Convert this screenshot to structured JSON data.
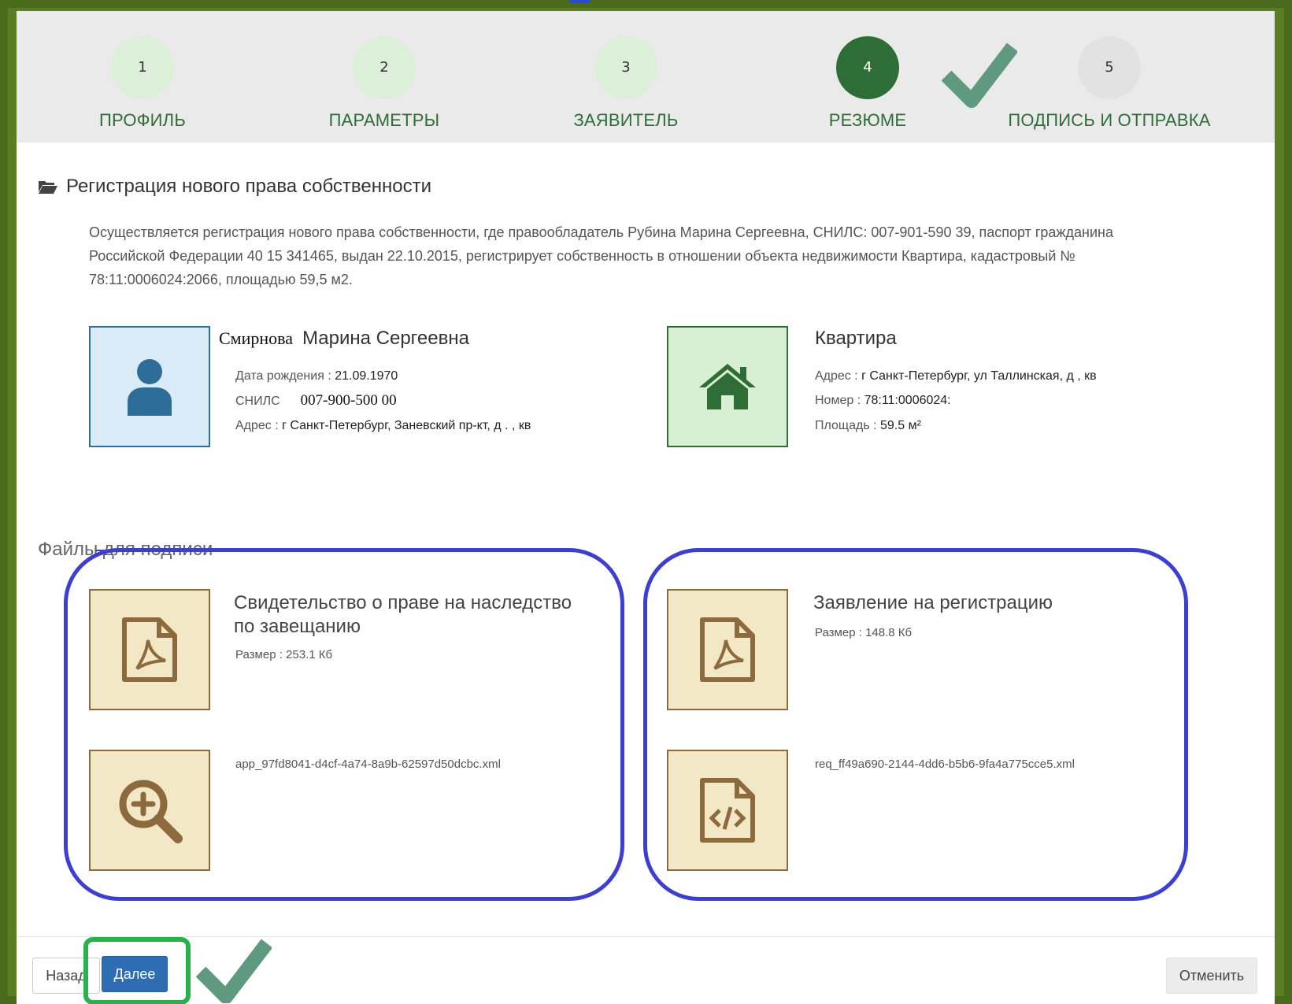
{
  "wizard": {
    "steps": [
      {
        "number": "1",
        "label": "ПРОФИЛЬ"
      },
      {
        "number": "2",
        "label": "ПАРАМЕТРЫ"
      },
      {
        "number": "3",
        "label": "ЗАЯВИТЕЛЬ"
      },
      {
        "number": "4",
        "label": "РЕЗЮМЕ"
      },
      {
        "number": "5",
        "label": "ПОДПИСЬ И ОТПРАВКА"
      }
    ],
    "active_step": 4
  },
  "section": {
    "title": "Регистрация нового права собственности",
    "description": "Осуществляется регистрация нового права собственности, где правообладатель Рубина Марина Сергеевна, СНИЛС: 007-901-590 39, паспорт гражданина Российской Федерации 40 15 341465, выдан 22.10.2015, регистрирует собственность в отношении объекта недвижимости Квартира, кадастровый № 78:11:0006024:2066, площадью 59,5 м2."
  },
  "person": {
    "surname": "Смирнова",
    "name": "Марина Сергеевна",
    "birth_label": "Дата рождения : ",
    "birth_value": "21.09.1970",
    "snils_label": "СНИЛС",
    "snils_value": "007-900-500 00",
    "address_label": "Адрес : ",
    "address_value": "г Санкт-Петербург, Заневский пр-кт, д  . , кв"
  },
  "property": {
    "title": "Квартира",
    "address_label": "Адрес : ",
    "address_value": "г Санкт-Петербург, ул Таллинская, д     , кв",
    "number_label": "Номер : ",
    "number_value": "78:11:0006024:",
    "area_label": "Площадь : ",
    "area_value": "59.5 м²"
  },
  "files": {
    "title": "Файлы для подписи",
    "items": [
      {
        "title": "Свидетельство о праве на наследство по завещанию",
        "size_label": "Размер : ",
        "size_value": "253.1 Кб",
        "xml": "app_97fd8041-d4cf-4a74-8a9b-62597d50dcbc.xml"
      },
      {
        "title": "Заявление на регистрацию",
        "size_label": "Размер : ",
        "size_value": "148.8 Кб",
        "xml": "req_ff49a690-2144-4dd6-b5b6-9fa4a775cce5.xml"
      }
    ]
  },
  "footer": {
    "back_label": "Назад",
    "next_label": "Далее",
    "cancel_label": "Отменить"
  },
  "colors": {
    "accent_green": "#2f6d36",
    "primary_blue": "#2e6db4",
    "annotation_blue": "#3c3fd0",
    "annotation_green": "#27b34a"
  }
}
